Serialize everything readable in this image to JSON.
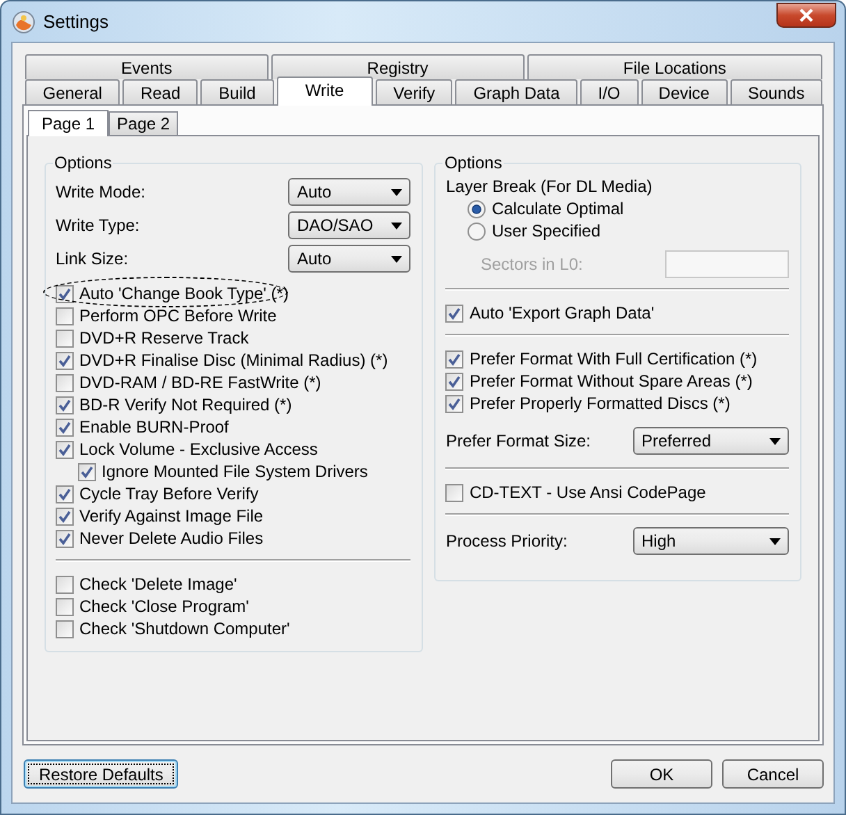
{
  "window": {
    "title": "Settings"
  },
  "tab_rows": [
    {
      "tabs": [
        {
          "label": "Events",
          "selected": false
        },
        {
          "label": "Registry",
          "selected": false
        },
        {
          "label": "File Locations",
          "selected": false
        }
      ]
    },
    {
      "tabs": [
        {
          "label": "General",
          "selected": false
        },
        {
          "label": "Read",
          "selected": false
        },
        {
          "label": "Build",
          "selected": false
        },
        {
          "label": "Write",
          "selected": true
        },
        {
          "label": "Verify",
          "selected": false
        },
        {
          "label": "Graph Data",
          "selected": false
        },
        {
          "label": "I/O",
          "selected": false
        },
        {
          "label": "Device",
          "selected": false
        },
        {
          "label": "Sounds",
          "selected": false
        }
      ]
    }
  ],
  "subtabs": [
    {
      "label": "Page 1",
      "selected": true
    },
    {
      "label": "Page 2",
      "selected": false
    }
  ],
  "left_group": {
    "title": "Options",
    "selects": [
      {
        "label": "Write Mode:",
        "value": "Auto"
      },
      {
        "label": "Write Type:",
        "value": "DAO/SAO"
      },
      {
        "label": "Link Size:",
        "value": "Auto"
      }
    ],
    "checks": [
      {
        "label": "Auto 'Change Book Type' (*)",
        "checked": true,
        "circled": true
      },
      {
        "label": "Perform OPC Before Write",
        "checked": false,
        "circled": false
      },
      {
        "label": "DVD+R Reserve Track",
        "checked": false,
        "circled": false
      },
      {
        "label": "DVD+R Finalise Disc (Minimal Radius) (*)",
        "checked": true,
        "circled": false
      },
      {
        "label": "DVD-RAM / BD-RE FastWrite (*)",
        "checked": false,
        "circled": false
      },
      {
        "label": "BD-R Verify Not Required (*)",
        "checked": true,
        "circled": false
      },
      {
        "label": "Enable BURN-Proof",
        "checked": true,
        "circled": false
      },
      {
        "label": "Lock Volume - Exclusive Access",
        "checked": true,
        "circled": false,
        "children": [
          {
            "label": "Ignore Mounted File System Drivers",
            "checked": true,
            "circled": false
          }
        ]
      },
      {
        "label": "Cycle Tray Before Verify",
        "checked": true,
        "circled": false
      },
      {
        "label": "Verify Against Image File",
        "checked": true,
        "circled": false
      },
      {
        "label": "Never Delete Audio Files",
        "checked": true,
        "circled": false
      }
    ],
    "final_checks": [
      {
        "label": "Check 'Delete Image'",
        "checked": false
      },
      {
        "label": "Check 'Close Program'",
        "checked": false
      },
      {
        "label": "Check 'Shutdown Computer'",
        "checked": false
      }
    ]
  },
  "right_group": {
    "title": "Options",
    "layer_break": {
      "label": "Layer Break (For DL Media)",
      "options": [
        {
          "label": "Calculate Optimal",
          "selected": true
        },
        {
          "label": "User Specified",
          "selected": false
        }
      ],
      "sectors": {
        "label": "Sectors in L0:",
        "disabled": true
      }
    },
    "export_checks": [
      {
        "label": "Auto 'Export Graph Data'",
        "checked": true
      }
    ],
    "format_checks": [
      {
        "label": "Prefer Format With Full Certification (*)",
        "checked": true
      },
      {
        "label": "Prefer Format Without Spare Areas (*)",
        "checked": true
      },
      {
        "label": "Prefer Properly Formatted Discs (*)",
        "checked": true
      }
    ],
    "format_size": {
      "label": "Prefer Format Size:",
      "value": "Preferred"
    },
    "cdtext_checks": [
      {
        "label": "CD-TEXT - Use Ansi CodePage",
        "checked": false
      }
    ],
    "priority": {
      "label": "Process Priority:",
      "value": "High"
    }
  },
  "buttons": [
    {
      "label": "Restore Defaults",
      "focused": true
    },
    {
      "label": "OK",
      "focused": false
    },
    {
      "label": "Cancel",
      "focused": false
    }
  ]
}
